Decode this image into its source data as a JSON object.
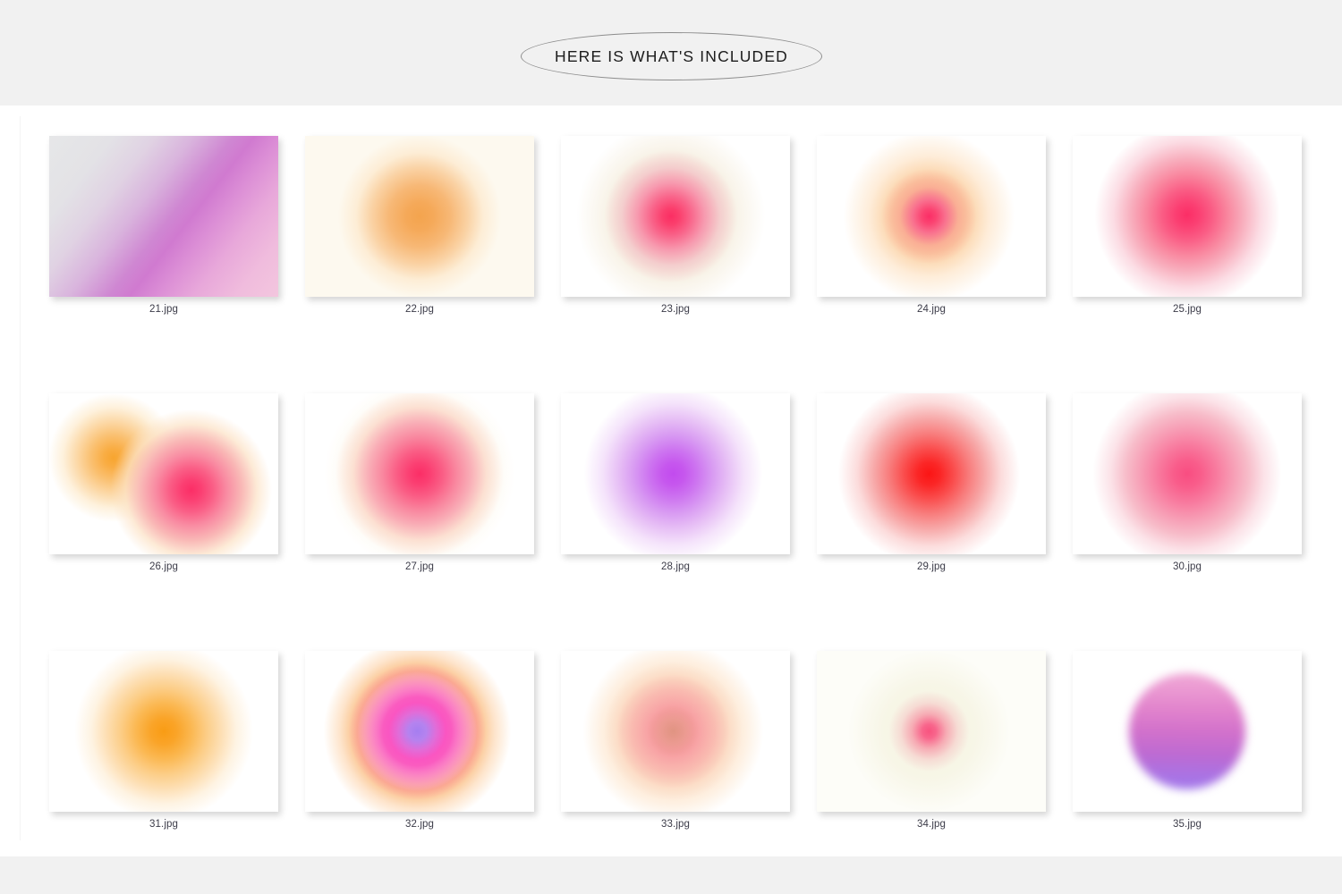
{
  "page": {
    "header_title": "HERE IS WHAT'S INCLUDED",
    "background_band_color": "#f1f1f1",
    "content_background": "#ffffff",
    "caption_color": "#3b3b48"
  },
  "gallery": {
    "columns": 5,
    "rows": 3,
    "items": [
      {
        "label": "21.jpg",
        "swatch": "sw-21",
        "description": "diagonal gradient gray to purple to pink",
        "colors": [
          "#e6e7e8",
          "#cf87d2",
          "#f3c6de"
        ]
      },
      {
        "label": "22.jpg",
        "swatch": "sw-22",
        "description": "orange radial glow on cream background",
        "colors": [
          "#fdf9ef",
          "#f4a44e"
        ]
      },
      {
        "label": "23.jpg",
        "swatch": "sw-23",
        "description": "pink core with warm tan halo on white",
        "colors": [
          "#fb2e63",
          "#e2c896",
          "#ffffff"
        ]
      },
      {
        "label": "24.jpg",
        "swatch": "sw-24",
        "description": "pink core with orange halo on white",
        "colors": [
          "#fb2e66",
          "#f9b268",
          "#ffffff"
        ]
      },
      {
        "label": "25.jpg",
        "swatch": "sw-25",
        "description": "pink radial glow on white",
        "colors": [
          "#fb2e66",
          "#ffffff"
        ]
      },
      {
        "label": "26.jpg",
        "swatch": "sw-26",
        "description": "overlapping orange and pink blobs",
        "colors": [
          "#f8a52f",
          "#fb2e66",
          "#ffffff"
        ]
      },
      {
        "label": "27.jpg",
        "swatch": "sw-27",
        "description": "pink radial glow with cream edge",
        "colors": [
          "#fb2e66",
          "#f7e0b4",
          "#ffffff"
        ]
      },
      {
        "label": "28.jpg",
        "swatch": "sw-28",
        "description": "purple violet radial glow on white",
        "colors": [
          "#c24bee",
          "#ffffff"
        ]
      },
      {
        "label": "29.jpg",
        "swatch": "sw-29",
        "description": "bright red radial glow on white",
        "colors": [
          "#fb1515",
          "#ffffff"
        ]
      },
      {
        "label": "30.jpg",
        "swatch": "sw-30",
        "description": "soft pink radial glow on white",
        "colors": [
          "#f94d81",
          "#ffffff"
        ]
      },
      {
        "label": "31.jpg",
        "swatch": "sw-31",
        "description": "orange radial glow on white",
        "colors": [
          "#f99c14",
          "#ffffff"
        ]
      },
      {
        "label": "32.jpg",
        "swatch": "sw-32",
        "description": "purple core, magenta ring, orange outer ring",
        "colors": [
          "#a57ef0",
          "#fc45c8",
          "#faae64"
        ]
      },
      {
        "label": "33.jpg",
        "swatch": "sw-33",
        "description": "salmon peach glow with muted tan center",
        "colors": [
          "#f79198",
          "#f9c490",
          "#d49676"
        ]
      },
      {
        "label": "34.jpg",
        "swatch": "sw-34",
        "description": "faint pink center on pale cream green",
        "colors": [
          "#f8537f",
          "#e8e2ba",
          "#fdfdf8"
        ]
      },
      {
        "label": "35.jpg",
        "swatch": "sw-35",
        "description": "solid circle with pink to purple vertical gradient",
        "colors": [
          "#f0a8d6",
          "#a079ec",
          "#ffffff"
        ]
      }
    ]
  }
}
